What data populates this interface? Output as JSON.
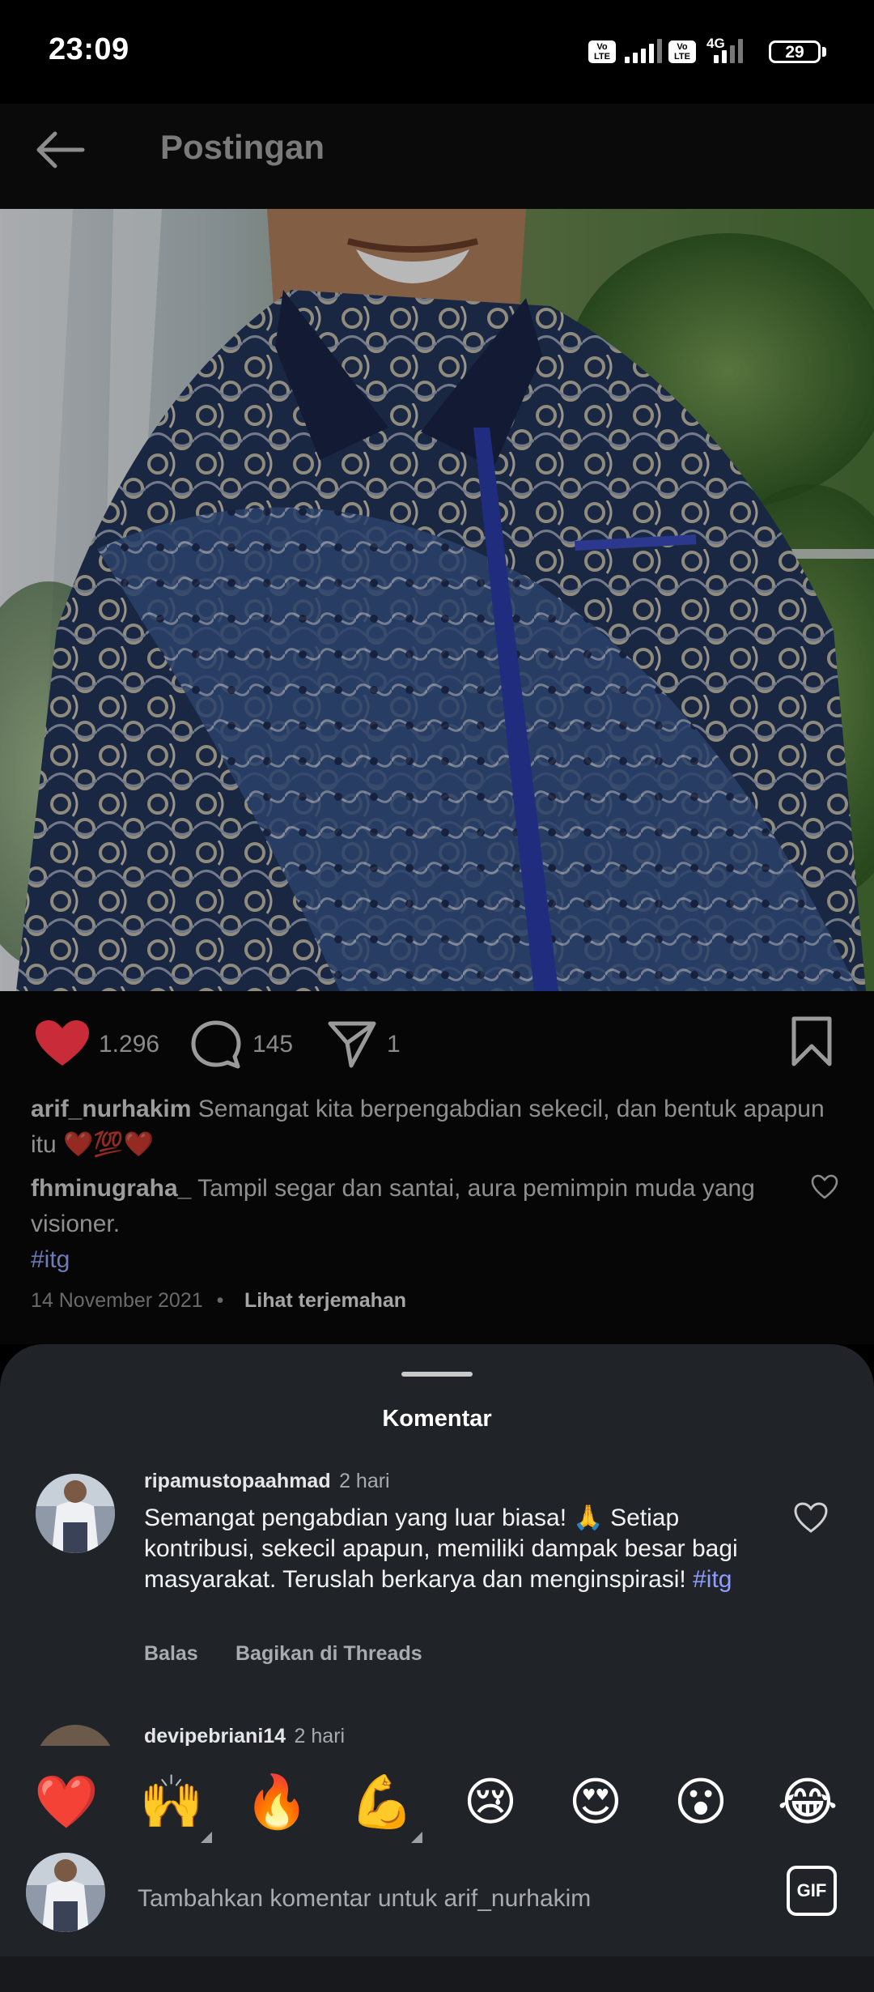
{
  "status_bar": {
    "time": "23:09",
    "sim1": "Vo LTE",
    "sim2": "Vo LTE",
    "network": "4G",
    "battery": "29"
  },
  "header": {
    "title": "Postingan"
  },
  "actions": {
    "likes": "1.296",
    "comments": "145",
    "shares": "1"
  },
  "caption": {
    "username": "arif_nurhakim",
    "text": "Semangat kita berpengabdian sekecil, dan bentuk apapun itu",
    "emoji": "❤️💯❤️"
  },
  "top_comment": {
    "username": "fhminugraha_",
    "text": "Tampil segar dan santai, aura pemimpin muda yang visioner.",
    "hashtag": "#itg"
  },
  "post_meta": {
    "date": "14 November 2021",
    "separator": "•",
    "translate": "Lihat terjemahan"
  },
  "sheet": {
    "title": "Komentar",
    "comments": [
      {
        "username": "ripamustopaahmad",
        "time": "2 hari",
        "text": "Semangat pengabdian yang luar biasa! 🙏 Setiap kontribusi, sekecil apapun, memiliki dampak besar bagi masyarakat. Teruslah berkarya dan menginspirasi!",
        "hashtag": "#itg",
        "reply": "Balas",
        "share": "Bagikan di Threads"
      },
      {
        "username": "devipebriani14",
        "time": "2 hari"
      }
    ]
  },
  "emoji_bar": [
    "❤️",
    "🙌",
    "🔥",
    "💪",
    "😢",
    "😍",
    "😮",
    "😂"
  ],
  "composer": {
    "placeholder": "Tambahkan komentar untuk arif_nurhakim",
    "gif": "GIF"
  },
  "colors": {
    "like_red": "#e0313f",
    "hashtag": "#8f9cff",
    "sheet_bg": "#202428"
  }
}
